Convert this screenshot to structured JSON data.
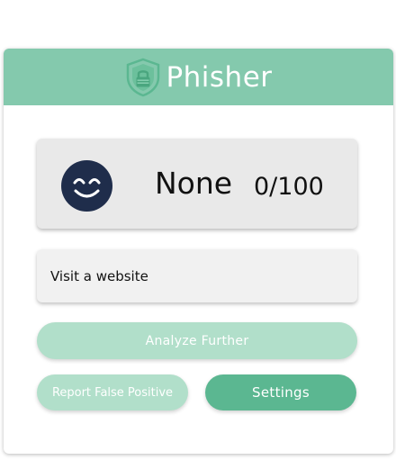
{
  "header": {
    "brand": "Phisher",
    "logo_icon": "shield-lock-icon"
  },
  "status": {
    "icon": "smiling-face-icon",
    "label": "None",
    "score": "0/100"
  },
  "site": {
    "text": "Visit a website"
  },
  "buttons": {
    "analyze": "Analyze Further",
    "report": "Report False Positive",
    "settings": "Settings"
  },
  "colors": {
    "header": "#84c9ad",
    "button_light": "#b1dfca",
    "button_primary": "#5bb791",
    "face": "#1f2d4b"
  }
}
